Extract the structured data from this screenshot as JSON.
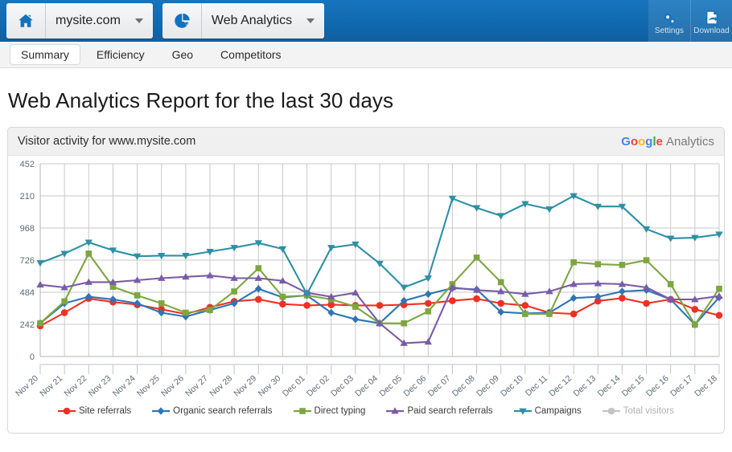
{
  "topbar": {
    "site_chip": {
      "icon": "home-icon",
      "label": "mysite.com",
      "caret": "chevron-down-icon"
    },
    "app_chip": {
      "icon": "pie-chart-icon",
      "label": "Web Analytics",
      "caret": "chevron-down-icon"
    },
    "tools": [
      {
        "icon": "gears-icon",
        "label": "Settings"
      },
      {
        "icon": "download-document-icon",
        "label": "Download"
      }
    ]
  },
  "tabs": [
    {
      "label": "Summary",
      "active": true
    },
    {
      "label": "Efficiency",
      "active": false
    },
    {
      "label": "Geo",
      "active": false
    },
    {
      "label": "Competitors",
      "active": false
    }
  ],
  "page_title": "Web Analytics Report for the last 30 days",
  "panel": {
    "title": "Visitor activity for www.mysite.com",
    "brand": {
      "letters": [
        "G",
        "o",
        "o",
        "g",
        "l",
        "e"
      ],
      "suffix": "Analytics"
    }
  },
  "chart_data": {
    "type": "line",
    "title": "Visitor activity for www.mysite.com",
    "xlabel": "",
    "ylabel": "",
    "grid": true,
    "legend_position": "bottom",
    "ylim": [
      0,
      1452
    ],
    "ytick_labels": [
      "452",
      "210",
      "968",
      "726",
      "484",
      "242",
      "0"
    ],
    "ytick_values": [
      1452,
      1210,
      968,
      726,
      484,
      242,
      0
    ],
    "categories": [
      "Nov 20",
      "Nov 21",
      "Nov 22",
      "Nov 23",
      "Nov 24",
      "Nov 25",
      "Nov 26",
      "Nov 27",
      "Nov 28",
      "Nov 29",
      "Nov 30",
      "Dec 01",
      "Dec 02",
      "Dec 03",
      "Dec 04",
      "Dec 05",
      "Dec 06",
      "Dec 07",
      "Dec 08",
      "Dec 09",
      "Dec 10",
      "Dec 11",
      "Dec 12",
      "Dec 13",
      "Dec 14",
      "Dec 15",
      "Dec 16",
      "Dec 17",
      "Dec 18"
    ],
    "series": [
      {
        "name": "Site referrals",
        "color": "#ee3124",
        "marker": "circle",
        "visible": true,
        "values": [
          230,
          330,
          437,
          410,
          390,
          355,
          320,
          370,
          415,
          430,
          395,
          385,
          390,
          385,
          385,
          390,
          400,
          420,
          435,
          400,
          385,
          330,
          320,
          418,
          440,
          400,
          430,
          355,
          310
        ]
      },
      {
        "name": "Organic search referrals",
        "color": "#2e75b6",
        "marker": "diamond",
        "visible": true,
        "values": [
          250,
          400,
          450,
          430,
          400,
          330,
          300,
          350,
          400,
          510,
          445,
          460,
          330,
          280,
          250,
          420,
          470,
          515,
          505,
          335,
          325,
          330,
          440,
          450,
          490,
          500,
          430,
          240,
          445
        ]
      },
      {
        "name": "Direct typing",
        "color": "#7da640",
        "marker": "square",
        "visible": true,
        "values": [
          250,
          415,
          775,
          525,
          460,
          400,
          330,
          350,
          490,
          665,
          450,
          460,
          430,
          375,
          250,
          250,
          340,
          545,
          745,
          560,
          320,
          320,
          710,
          695,
          690,
          725,
          545,
          240,
          510
        ]
      },
      {
        "name": "Paid search referrals",
        "color": "#7a5ba9",
        "marker": "triangle",
        "visible": true,
        "values": [
          540,
          520,
          560,
          560,
          575,
          590,
          600,
          610,
          590,
          590,
          570,
          480,
          450,
          480,
          250,
          100,
          110,
          520,
          500,
          490,
          470,
          490,
          545,
          550,
          545,
          520,
          430,
          430,
          455
        ]
      },
      {
        "name": "Campaigns",
        "color": "#2e8fa6",
        "marker": "triangle-down",
        "visible": true,
        "values": [
          705,
          775,
          860,
          800,
          755,
          760,
          760,
          790,
          820,
          855,
          810,
          470,
          820,
          845,
          700,
          520,
          590,
          1190,
          1120,
          1060,
          1150,
          1110,
          1210,
          1130,
          1130,
          960,
          890,
          895,
          920
        ]
      },
      {
        "name": "Total visitors",
        "color": "#c8c8c8",
        "marker": "circle",
        "visible": false,
        "values": []
      }
    ]
  }
}
